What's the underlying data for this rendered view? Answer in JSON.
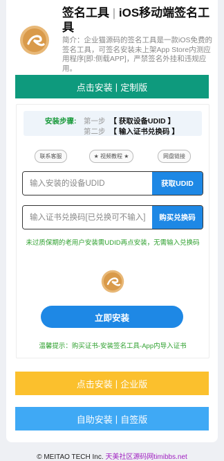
{
  "header": {
    "title_main": "签名工具",
    "title_sep": "|",
    "title_sub": "iOS移动端签名工具",
    "description": "简介：企业猫源码的签名工具是一款iOS免费的签名工具，可签名安装未上架App Store内测应用程序[即:侧载APP]，严禁签名外挂和违规应用。"
  },
  "buttons": {
    "custom": {
      "left": "点击安装",
      "sep": "|",
      "right": "定制版"
    },
    "enterprise": {
      "left": "点击安装",
      "sep": "|",
      "right": "企业版"
    },
    "self": {
      "left": "自助安装",
      "sep": "|",
      "right": "自签版"
    }
  },
  "steps": {
    "label": "安装步骤:",
    "items": [
      {
        "num": "第一步",
        "text": "【 获取设备UDID 】"
      },
      {
        "num": "第二步",
        "text": "【 输入证书兑换码 】"
      }
    ]
  },
  "pills": [
    "联系客服",
    "★ 视频教程 ★",
    "网盘链接"
  ],
  "udid": {
    "placeholder": "输入安装的设备UDID",
    "button": "获取UDID"
  },
  "code": {
    "placeholder": "输入证书兑换码[已兑换可不输入]",
    "button": "购买兑换码"
  },
  "notice": "未过质保期的老用户安装需UDID再点安装，无需输入兑换码",
  "install_button": "立即安装",
  "tip": "温馨提示：购买证书-安装签名工具-App内导入证书",
  "footer": {
    "copyright": "© MEITAO TECH Inc.",
    "link": "天美社区源码网timibbs.net"
  },
  "colors": {
    "green": "#0e9a7d",
    "yellow": "#fbc02d",
    "blue": "#3fa9f5",
    "accent": "#1e88e5"
  }
}
